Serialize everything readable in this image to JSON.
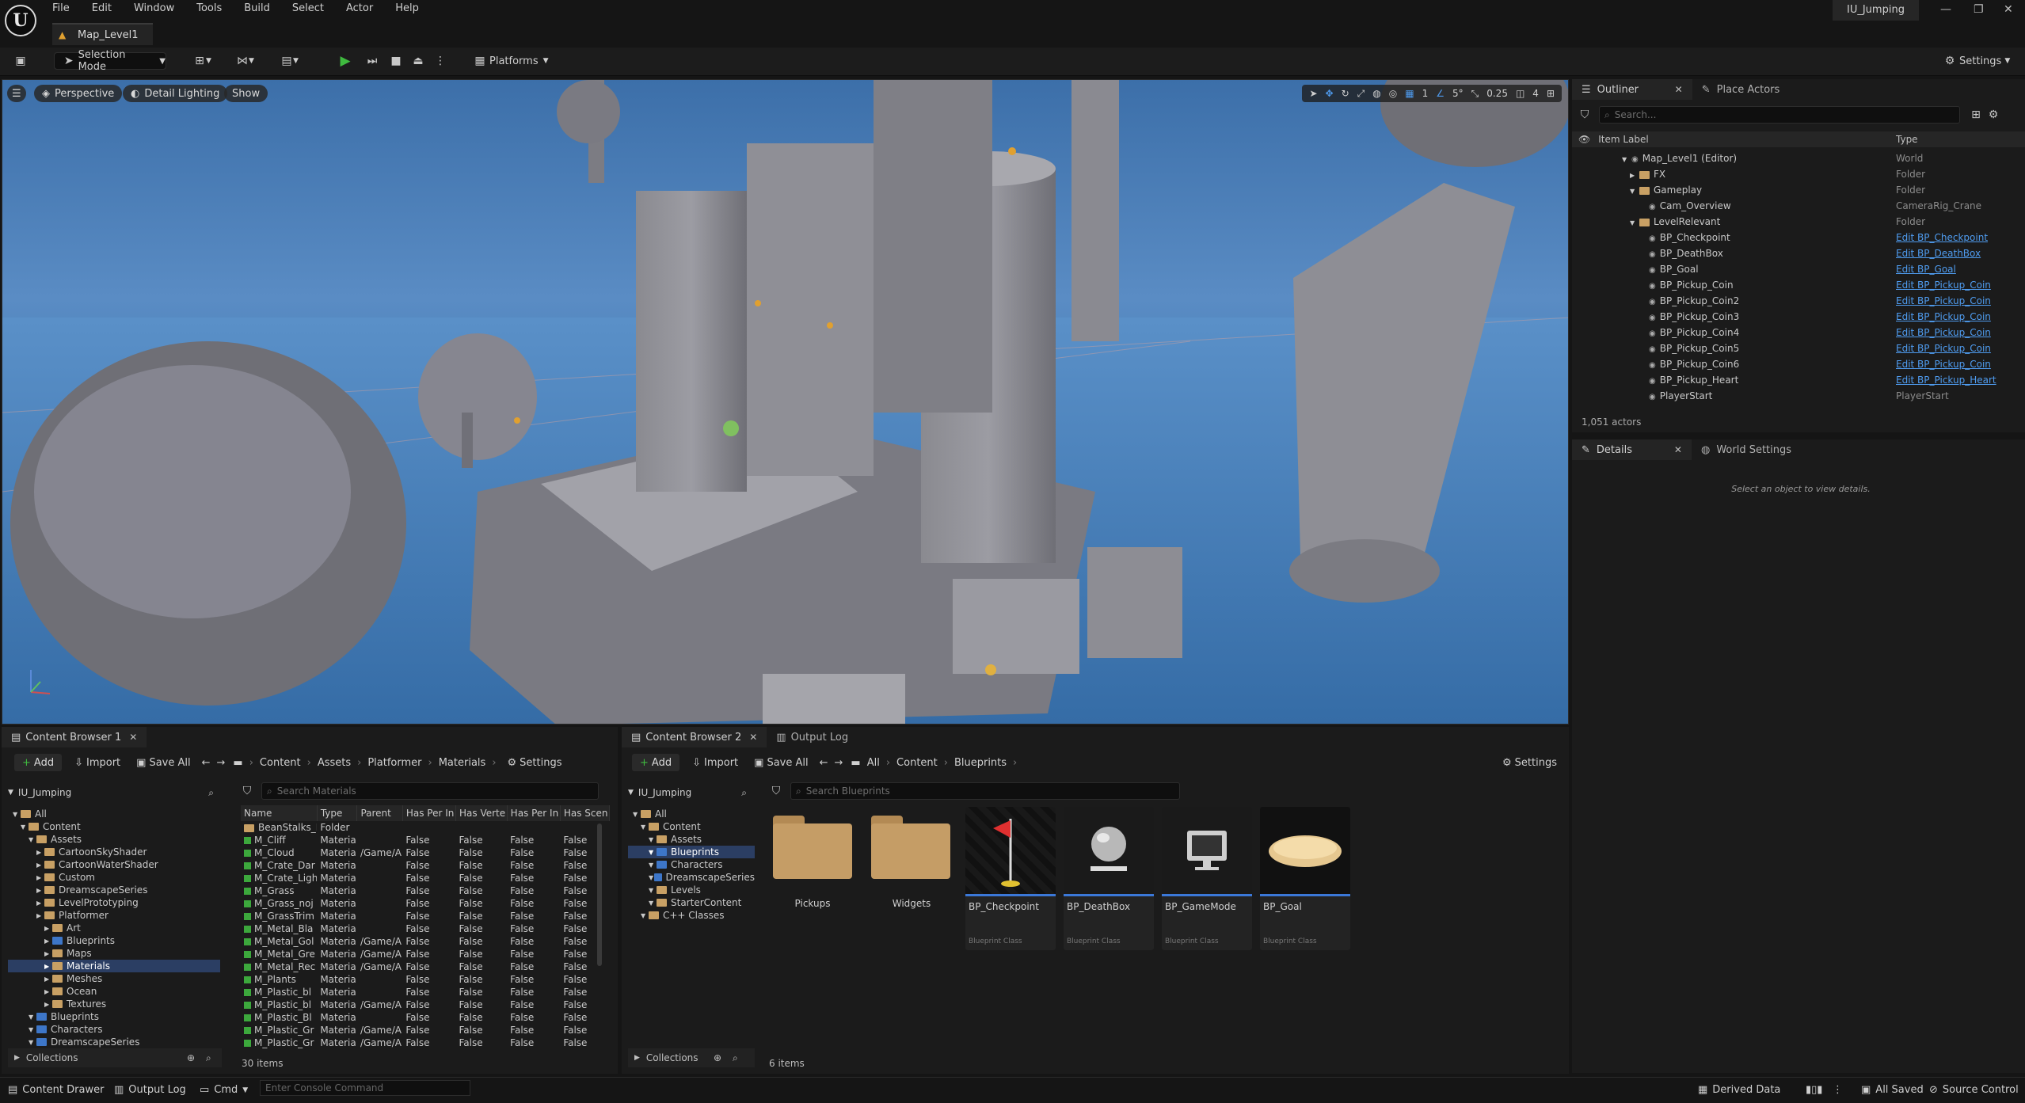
{
  "app": {
    "menu": [
      "File",
      "Edit",
      "Window",
      "Tools",
      "Build",
      "Select",
      "Actor",
      "Help"
    ],
    "map_tab": "Map_Level1",
    "project_name": "IU_Jumping",
    "window_controls": [
      "minimize",
      "restore",
      "close"
    ]
  },
  "toolbar": {
    "selection_mode": "Selection Mode",
    "platforms": "Platforms",
    "settings": "Settings"
  },
  "viewport": {
    "perspective": "Perspective",
    "lighting": "Detail Lighting",
    "show": "Show",
    "snap_grid": "1",
    "snap_angle": "5°",
    "snap_scale": "0.25",
    "camera_speed": "4"
  },
  "outliner": {
    "tab": "Outliner",
    "place_actors_tab": "Place Actors",
    "search_placeholder": "Search...",
    "col_label": "Item Label",
    "col_type": "Type",
    "rows": [
      {
        "label": "Map_Level1 (Editor)",
        "type": "World",
        "link": false
      },
      {
        "label": "FX",
        "type": "Folder",
        "link": false
      },
      {
        "label": "Gameplay",
        "type": "Folder",
        "link": false
      },
      {
        "label": "Cam_Overview",
        "type": "CameraRig_Crane",
        "link": false
      },
      {
        "label": "LevelRelevant",
        "type": "Folder",
        "link": false
      },
      {
        "label": "BP_Checkpoint",
        "type": "Edit BP_Checkpoint",
        "link": true
      },
      {
        "label": "BP_DeathBox",
        "type": "Edit BP_DeathBox",
        "link": true
      },
      {
        "label": "BP_Goal",
        "type": "Edit BP_Goal",
        "link": true
      },
      {
        "label": "BP_Pickup_Coin",
        "type": "Edit BP_Pickup_Coin",
        "link": true
      },
      {
        "label": "BP_Pickup_Coin2",
        "type": "Edit BP_Pickup_Coin",
        "link": true
      },
      {
        "label": "BP_Pickup_Coin3",
        "type": "Edit BP_Pickup_Coin",
        "link": true
      },
      {
        "label": "BP_Pickup_Coin4",
        "type": "Edit BP_Pickup_Coin",
        "link": true
      },
      {
        "label": "BP_Pickup_Coin5",
        "type": "Edit BP_Pickup_Coin",
        "link": true
      },
      {
        "label": "BP_Pickup_Coin6",
        "type": "Edit BP_Pickup_Coin",
        "link": true
      },
      {
        "label": "BP_Pickup_Heart",
        "type": "Edit BP_Pickup_Heart",
        "link": true
      },
      {
        "label": "PlayerStart",
        "type": "PlayerStart",
        "link": false
      }
    ],
    "actor_count": "1,051 actors"
  },
  "details": {
    "tab": "Details",
    "world_settings_tab": "World Settings",
    "empty_message": "Select an object to view details."
  },
  "content_browser_1": {
    "tab": "Content Browser 1",
    "add": "Add",
    "import": "Import",
    "save_all": "Save All",
    "breadcrumb": [
      "Content",
      "Assets",
      "Platformer",
      "Materials"
    ],
    "settings": "Settings",
    "root": "IU_Jumping",
    "search_placeholder": "Search Materials",
    "tree": [
      {
        "label": "All",
        "indent": 0
      },
      {
        "label": "Content",
        "indent": 1
      },
      {
        "label": "Assets",
        "indent": 2
      },
      {
        "label": "CartoonSkyShader",
        "indent": 3
      },
      {
        "label": "CartoonWaterShader",
        "indent": 3
      },
      {
        "label": "Custom",
        "indent": 3
      },
      {
        "label": "DreamscapeSeries",
        "indent": 3
      },
      {
        "label": "LevelPrototyping",
        "indent": 3
      },
      {
        "label": "Platformer",
        "indent": 3
      },
      {
        "label": "Art",
        "indent": 4
      },
      {
        "label": "Blueprints",
        "indent": 4
      },
      {
        "label": "Maps",
        "indent": 4
      },
      {
        "label": "Materials",
        "indent": 4
      },
      {
        "label": "Meshes",
        "indent": 4
      },
      {
        "label": "Ocean",
        "indent": 4
      },
      {
        "label": "Textures",
        "indent": 4
      },
      {
        "label": "Blueprints",
        "indent": 2
      },
      {
        "label": "Characters",
        "indent": 2
      },
      {
        "label": "DreamscapeSeries",
        "indent": 2
      }
    ],
    "columns": [
      "Name",
      "Type",
      "Parent",
      "Has Per In",
      "Has Verte",
      "Has Per In",
      "Has Scen"
    ],
    "rows": [
      [
        "BeanStalks_I",
        "Folder",
        "",
        "",
        "",
        "",
        ""
      ],
      [
        "M_Cliff",
        "Materia",
        "",
        "False",
        "False",
        "False",
        "False"
      ],
      [
        "M_Cloud",
        "Materia",
        "/Game/A",
        "False",
        "False",
        "False",
        "False"
      ],
      [
        "M_Crate_Dar",
        "Materia",
        "",
        "False",
        "False",
        "False",
        "False"
      ],
      [
        "M_Crate_Ligh",
        "Materia",
        "",
        "False",
        "False",
        "False",
        "False"
      ],
      [
        "M_Grass",
        "Materia",
        "",
        "False",
        "False",
        "False",
        "False"
      ],
      [
        "M_Grass_noj",
        "Materia",
        "",
        "False",
        "False",
        "False",
        "False"
      ],
      [
        "M_GrassTrim",
        "Materia",
        "",
        "False",
        "False",
        "False",
        "False"
      ],
      [
        "M_Metal_Bla",
        "Materia",
        "",
        "False",
        "False",
        "False",
        "False"
      ],
      [
        "M_Metal_Gol",
        "Materia",
        "/Game/A",
        "False",
        "False",
        "False",
        "False"
      ],
      [
        "M_Metal_Gre",
        "Materia",
        "/Game/A",
        "False",
        "False",
        "False",
        "False"
      ],
      [
        "M_Metal_Rec",
        "Materia",
        "/Game/A",
        "False",
        "False",
        "False",
        "False"
      ],
      [
        "M_Plants",
        "Materia",
        "",
        "False",
        "False",
        "False",
        "False"
      ],
      [
        "M_Plastic_bl",
        "Materia",
        "",
        "False",
        "False",
        "False",
        "False"
      ],
      [
        "M_Plastic_bl",
        "Materia",
        "/Game/A",
        "False",
        "False",
        "False",
        "False"
      ],
      [
        "M_Plastic_Bl",
        "Materia",
        "",
        "False",
        "False",
        "False",
        "False"
      ],
      [
        "M_Plastic_Gr",
        "Materia",
        "/Game/A",
        "False",
        "False",
        "False",
        "False"
      ],
      [
        "M_Plastic_Gr",
        "Materia",
        "/Game/A",
        "False",
        "False",
        "False",
        "False"
      ]
    ],
    "collections": "Collections",
    "item_count": "30 items"
  },
  "content_browser_2": {
    "tab": "Content Browser 2",
    "output_log_tab": "Output Log",
    "add": "Add",
    "import": "Import",
    "save_all": "Save All",
    "breadcrumb": [
      "All",
      "Content",
      "Blueprints"
    ],
    "settings": "Settings",
    "root": "IU_Jumping",
    "search_placeholder": "Search Blueprints",
    "tree": [
      {
        "label": "All",
        "indent": 0
      },
      {
        "label": "Content",
        "indent": 1
      },
      {
        "label": "Assets",
        "indent": 2
      },
      {
        "label": "Blueprints",
        "indent": 2
      },
      {
        "label": "Characters",
        "indent": 2
      },
      {
        "label": "DreamscapeSeries",
        "indent": 2
      },
      {
        "label": "Levels",
        "indent": 2
      },
      {
        "label": "StarterContent",
        "indent": 2
      },
      {
        "label": "C++ Classes",
        "indent": 1
      }
    ],
    "folders": [
      "Pickups",
      "Widgets"
    ],
    "assets": [
      {
        "name": "BP_Checkpoint",
        "class": "Blueprint Class"
      },
      {
        "name": "BP_DeathBox",
        "class": "Blueprint Class"
      },
      {
        "name": "BP_GameMode",
        "class": "Blueprint Class"
      },
      {
        "name": "BP_Goal",
        "class": "Blueprint Class"
      }
    ],
    "collections": "Collections",
    "item_count": "6 items"
  },
  "statusbar": {
    "content_drawer": "Content Drawer",
    "output_log": "Output Log",
    "cmd": "Cmd",
    "console_placeholder": "Enter Console Command",
    "derived_data": "Derived Data",
    "all_saved": "All Saved",
    "source_control": "Source Control"
  }
}
